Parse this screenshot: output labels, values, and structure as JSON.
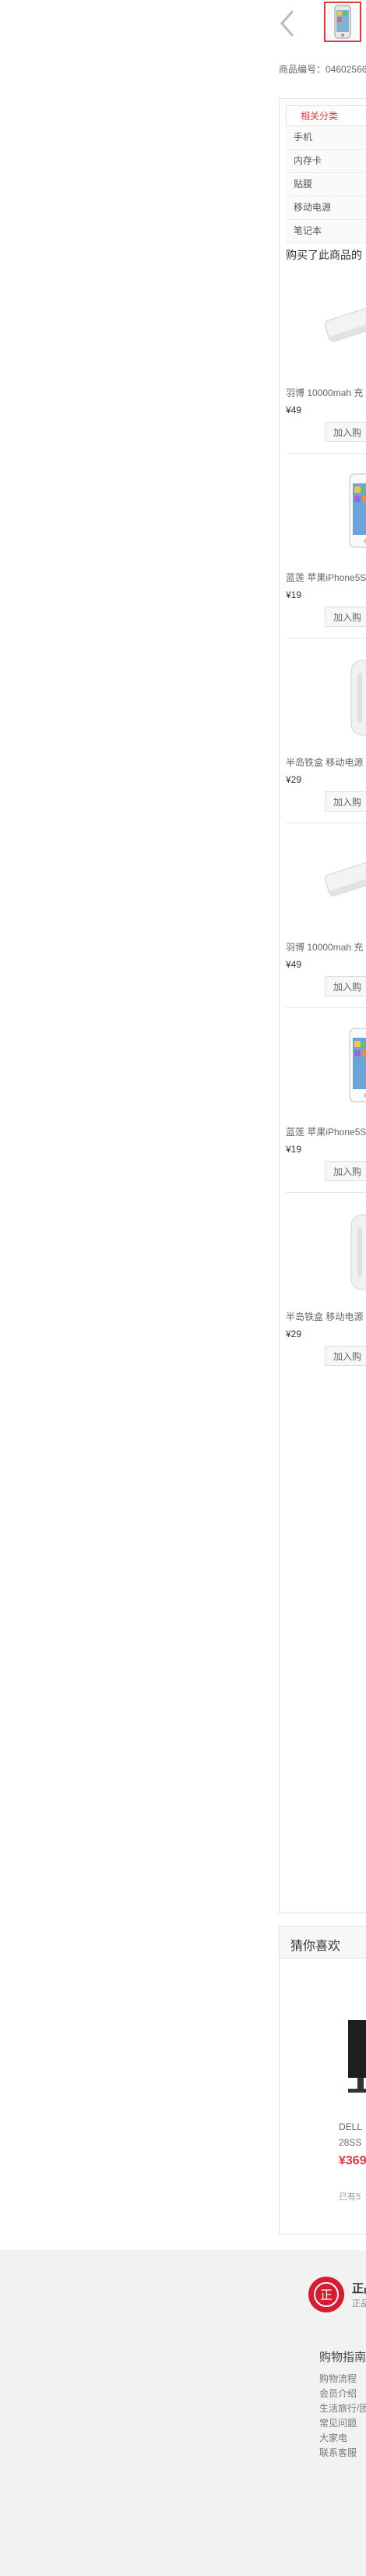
{
  "gallery": {
    "prev_label": "‹"
  },
  "sku_line": "商品编号：04602566",
  "categories": {
    "tab_label": "相关分类",
    "items": [
      {
        "label": "手机"
      },
      {
        "label": "内存卡"
      },
      {
        "label": "贴膜"
      },
      {
        "label": "移动电源"
      },
      {
        "label": "笔记本"
      }
    ]
  },
  "also_bought": {
    "title": "购买了此商品的",
    "products": [
      {
        "name": "羽博 10000mah 充",
        "price": "¥49",
        "cart": "加入购",
        "icon": "power-bank-image"
      },
      {
        "name": "蓝莲 苹果iPhone5S",
        "price": "¥19",
        "cart": "加入购",
        "icon": "phone-film-image"
      },
      {
        "name": "半岛铁盒 移动电源",
        "price": "¥29",
        "cart": "加入购",
        "icon": "power-bank-cylinder-image"
      },
      {
        "name": "羽博 10000mah 充",
        "price": "¥49",
        "cart": "加入购",
        "icon": "power-bank-image"
      },
      {
        "name": "蓝莲 苹果iPhone5S",
        "price": "¥19",
        "cart": "加入购",
        "icon": "phone-film-image"
      },
      {
        "name": "半岛铁盒 移动电源",
        "price": "¥29",
        "cart": "加入购",
        "icon": "power-bank-cylinder-image"
      }
    ]
  },
  "guess": {
    "title": "猜你喜欢",
    "product": {
      "name_line1": "DELL",
      "name_line2": "28SS",
      "price": "¥369",
      "reviews": "已有5"
    }
  },
  "footer": {
    "promise_icon_text": "正",
    "promise_title": "正品",
    "promise_sub": "正品",
    "guide_title": "购物指南",
    "guide_items": [
      "购物流程",
      "会员介绍",
      "生活旅行/团",
      "常见问题",
      "大家电",
      "联系客服"
    ]
  },
  "colors": {
    "accent": "#e4393c",
    "footer_bg": "#f2f2f2",
    "promise": "#d71c30"
  }
}
